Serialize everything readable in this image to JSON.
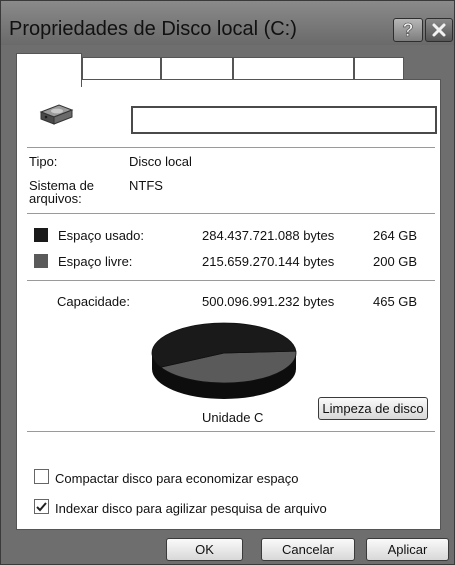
{
  "window": {
    "title": "Propriedades de Disco local (C:)",
    "help_icon": "question-mark-icon",
    "close_icon": "close-x-icon"
  },
  "tabs": [
    "",
    "",
    "",
    "",
    "",
    ""
  ],
  "drive": {
    "icon": "hard-drive-icon",
    "name_value": ""
  },
  "info": {
    "type_label": "Tipo:",
    "type_value": "Disco local",
    "fs_label_line1": "Sistema de",
    "fs_label_line2": "arquivos:",
    "fs_value": "NTFS"
  },
  "usage": {
    "used_label": "Espaço usado:",
    "used_bytes": "284.437.721.088 bytes",
    "used_gb": "264 GB",
    "used_color": "#1a1a1a",
    "free_label": "Espaço livre:",
    "free_bytes": "215.659.270.144 bytes",
    "free_gb": "200 GB",
    "free_color": "#5a5a5a",
    "capacity_label": "Capacidade:",
    "capacity_bytes": "500.096.991.232 bytes",
    "capacity_gb": "465 GB"
  },
  "chart_data": {
    "type": "pie",
    "slices": [
      {
        "name": "Espaço usado",
        "value": 284437721088
      },
      {
        "name": "Espaço livre",
        "value": 215659270144
      }
    ]
  },
  "drive_label": "Unidade C",
  "cleanup_button": "Limpeza de disco",
  "options": {
    "compress_label": "Compactar disco para economizar espaço",
    "compress_checked": false,
    "index_label": "Indexar disco para agilizar pesquisa de arquivo",
    "index_checked": true
  },
  "buttons": {
    "ok": "OK",
    "cancel": "Cancelar",
    "apply": "Aplicar"
  }
}
